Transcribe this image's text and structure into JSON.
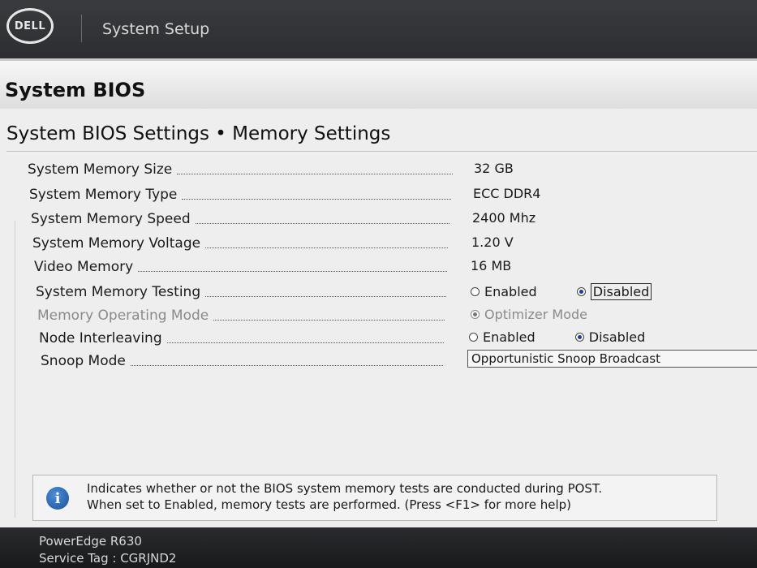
{
  "header": {
    "logo_text": "DELL",
    "app_title": "System Setup"
  },
  "page": {
    "title": "System BIOS",
    "section_title": "System BIOS Settings • Memory Settings"
  },
  "settings": {
    "memory_size": {
      "label": "System Memory Size",
      "value": "32 GB"
    },
    "memory_type": {
      "label": "System Memory Type",
      "value": "ECC DDR4"
    },
    "memory_speed": {
      "label": "System Memory Speed",
      "value": "2400 Mhz"
    },
    "memory_voltage": {
      "label": "System Memory Voltage",
      "value": "1.20 V"
    },
    "video_memory": {
      "label": "Video Memory",
      "value": "16 MB"
    },
    "memory_testing": {
      "label": "System Memory Testing",
      "option_enabled": "Enabled",
      "option_disabled": "Disabled",
      "selected": "Disabled"
    },
    "operating_mode": {
      "label": "Memory Operating Mode",
      "value": "Optimizer Mode"
    },
    "node_interleaving": {
      "label": "Node Interleaving",
      "option_enabled": "Enabled",
      "option_disabled": "Disabled",
      "selected": "Disabled"
    },
    "snoop_mode": {
      "label": "Snoop Mode",
      "value": "Opportunistic Snoop Broadcast"
    }
  },
  "help": {
    "line1": "Indicates whether or not the BIOS system memory tests are conducted during POST.",
    "line2": "When set to Enabled, memory tests are performed. (Press <F1> for more help)"
  },
  "footer": {
    "model": "PowerEdge R630",
    "service_tag": "Service Tag : CGRJND2"
  },
  "colors": {
    "accent": "#1a3aa8",
    "help_icon": "#1b4f9b"
  }
}
